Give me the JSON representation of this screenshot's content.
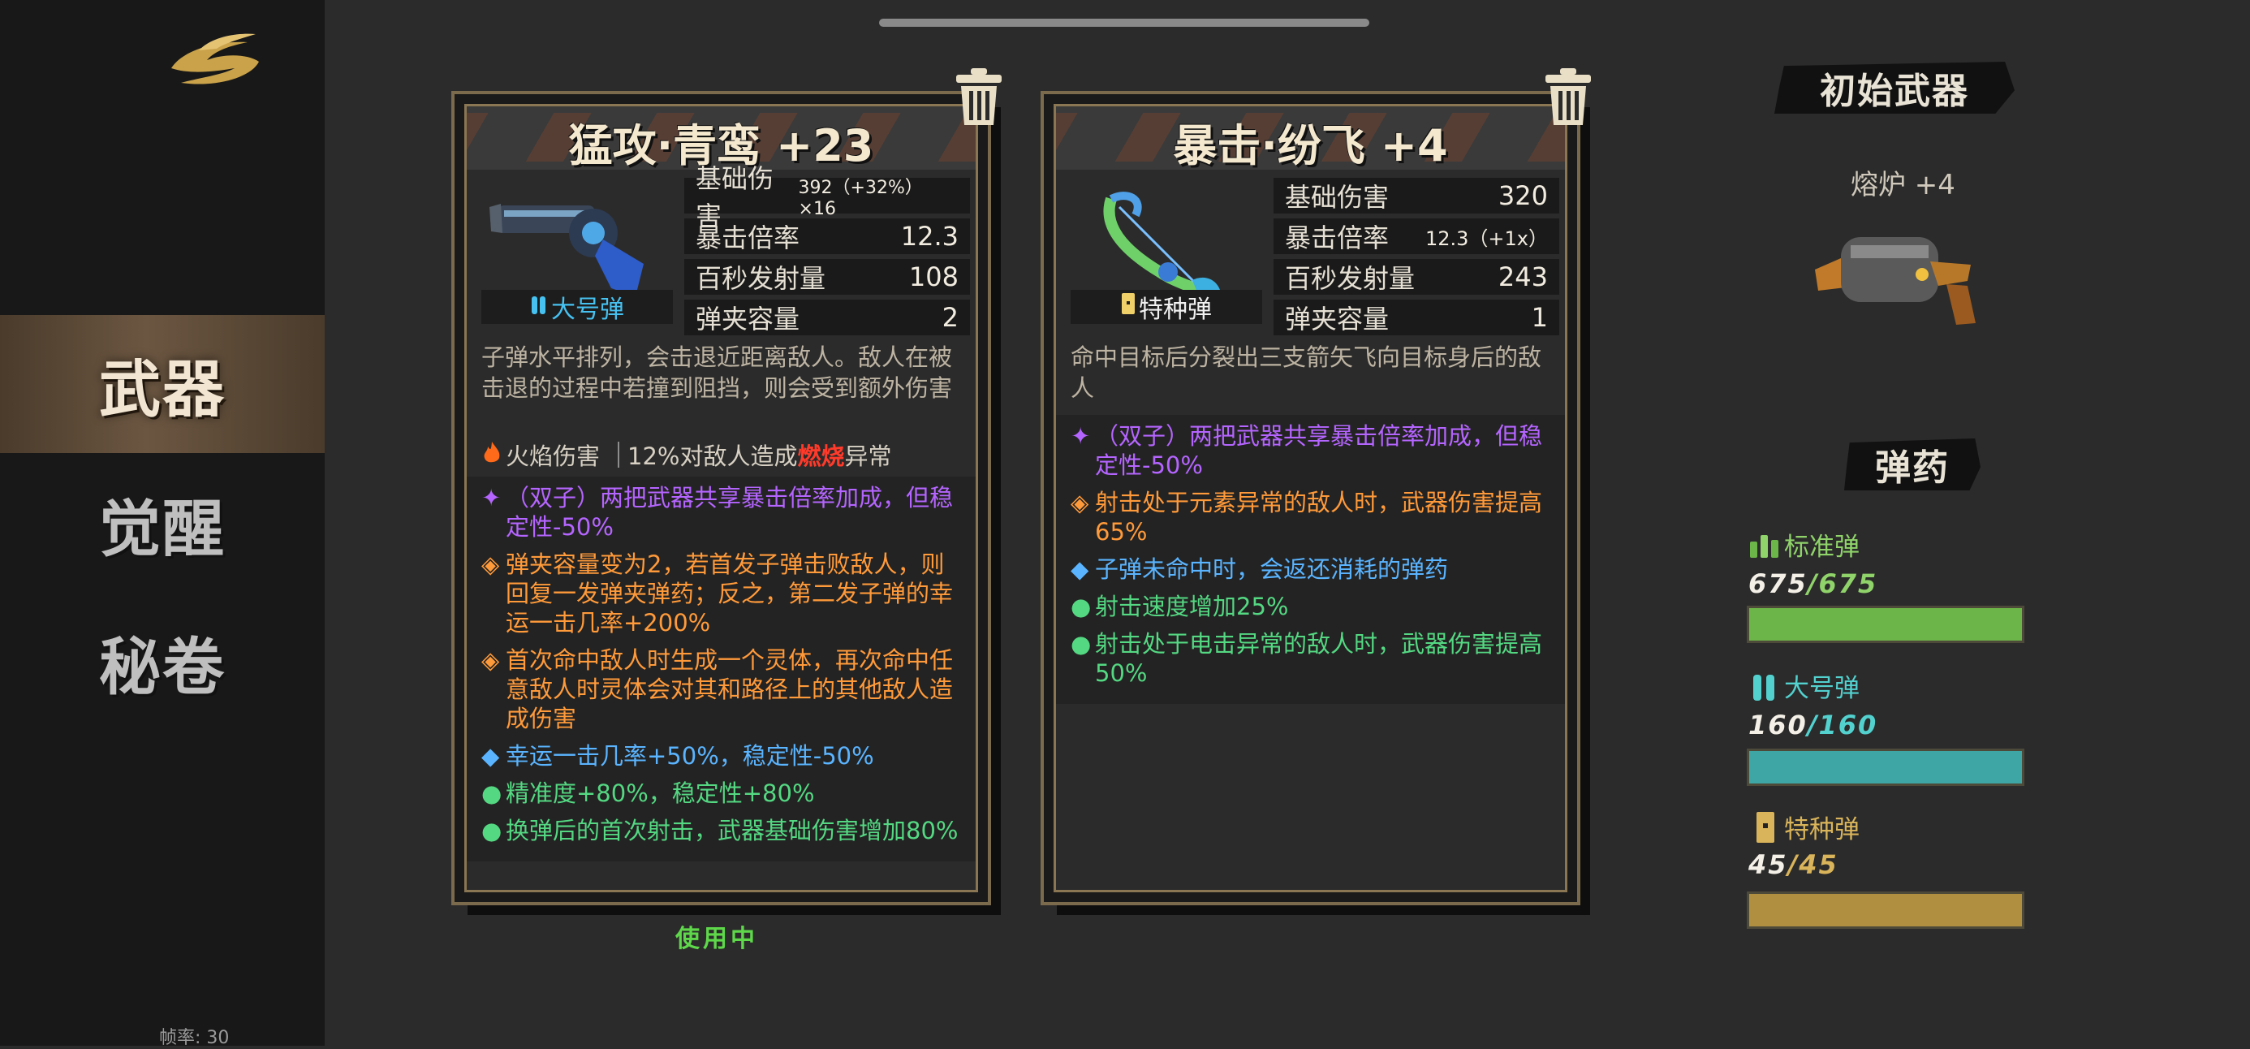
{
  "sidebar": {
    "items": [
      {
        "label": "武器",
        "active": true
      },
      {
        "label": "觉醒",
        "active": false
      },
      {
        "label": "秘卷",
        "active": false
      }
    ],
    "fps_label": "帧率: 30"
  },
  "weapons": [
    {
      "title": "猛攻·青鸾 +23",
      "ammo_type": "大号弹",
      "ammo_color": "#46c1f0",
      "stats": [
        {
          "label": "基础伤害",
          "value": "392（+32%）×16"
        },
        {
          "label": "暴击倍率",
          "value": "12.3"
        },
        {
          "label": "百秒发射量",
          "value": "108"
        },
        {
          "label": "弹夹容量",
          "value": "2"
        }
      ],
      "description": "子弹水平排列，会击退近距离敌人。敌人在被击退的过程中若撞到阻挡，则会受到额外伤害",
      "element": {
        "name": "火焰伤害",
        "effect_prefix": "12%对敌人造成",
        "effect_keyword": "燃烧",
        "effect_suffix": "异常"
      },
      "traits": [
        {
          "color": "purple",
          "marker": "✦",
          "text": "（双子）两把武器共享暴击倍率加成，但稳定性-50%"
        },
        {
          "color": "orange",
          "marker": "◈",
          "text": "弹夹容量变为2，若首发子弹击败敌人，则回复一发弹夹弹药；反之，第二发子弹的幸运一击几率+200%"
        },
        {
          "color": "orange",
          "marker": "◈",
          "text": "首次命中敌人时生成一个灵体，再次命中任意敌人时灵体会对其和路径上的其他敌人造成伤害"
        },
        {
          "color": "blue",
          "marker": "◆",
          "text": "幸运一击几率+50%，稳定性-50%"
        },
        {
          "color": "green",
          "marker": "●",
          "text": "精准度+80%，稳定性+80%"
        },
        {
          "color": "green",
          "marker": "●",
          "text": "换弹后的首次射击，武器基础伤害增加80%"
        }
      ],
      "status": "使用中"
    },
    {
      "title": "暴击·纷飞 +4",
      "ammo_type": "特种弹",
      "ammo_color": "#f1f1f1",
      "stats": [
        {
          "label": "基础伤害",
          "value": "320"
        },
        {
          "label": "暴击倍率",
          "value": "12.3（+1x）"
        },
        {
          "label": "百秒发射量",
          "value": "243"
        },
        {
          "label": "弹夹容量",
          "value": "1"
        }
      ],
      "description": "命中目标后分裂出三支箭矢飞向目标身后的敌人",
      "traits": [
        {
          "color": "purple",
          "marker": "✦",
          "text": "（双子）两把武器共享暴击倍率加成，但稳定性-50%"
        },
        {
          "color": "orange",
          "marker": "◈",
          "text": "射击处于元素异常的敌人时，武器伤害提高65%"
        },
        {
          "color": "blue",
          "marker": "◆",
          "text": "子弹未命中时，会返还消耗的弹药"
        },
        {
          "color": "green",
          "marker": "●",
          "text": "射击速度增加25%"
        },
        {
          "color": "green",
          "marker": "●",
          "text": "射击处于电击异常的敌人时，武器伤害提高50%"
        }
      ]
    }
  ],
  "initial_weapon": {
    "heading": "初始武器",
    "name": "熔炉 +4"
  },
  "ammo": {
    "heading": "弹药",
    "types": [
      {
        "name": "标准弹",
        "current": "675",
        "max": "675",
        "fraction": 1.0,
        "color": "#6cb548",
        "text_color": "#8fd36a"
      },
      {
        "name": "大号弹",
        "current": "160",
        "max": "160",
        "fraction": 1.0,
        "color": "#3ea7a6",
        "text_color": "#52d1cf"
      },
      {
        "name": "特种弹",
        "current": "45",
        "max": "45",
        "fraction": 1.0,
        "color": "#b08f40",
        "text_color": "#d9b45a"
      }
    ]
  }
}
